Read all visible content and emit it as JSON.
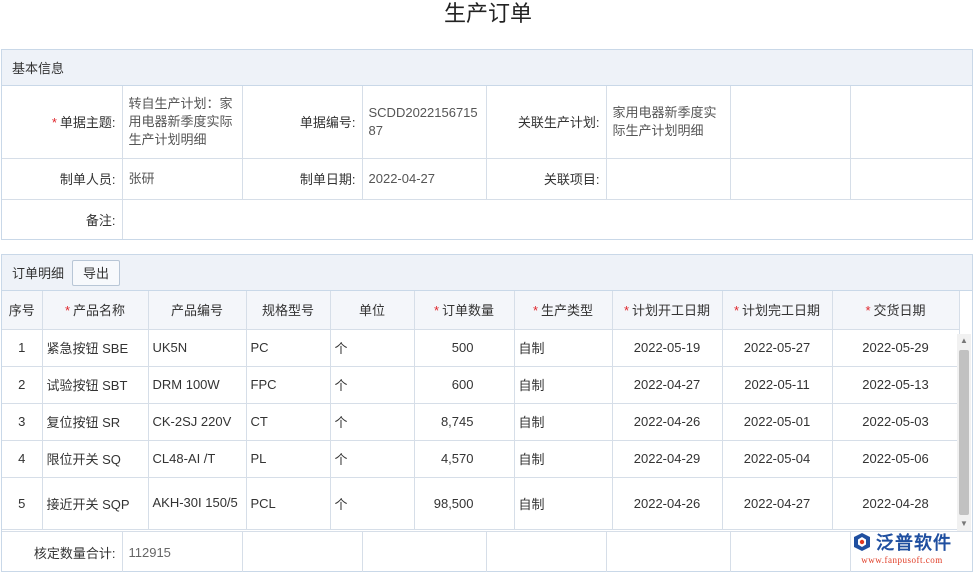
{
  "page": {
    "title": "生产订单"
  },
  "basic_info": {
    "header": "基本信息",
    "subject_label": "单据主题:",
    "subject_value": "转自生产计划：家用电器新季度实际生产计划明细",
    "doc_no_label": "单据编号:",
    "doc_no_value": "SCDD202215671587",
    "plan_label": "关联生产计划:",
    "plan_value": "家用电器新季度实际生产计划明细",
    "maker_label": "制单人员:",
    "maker_value": "张研",
    "date_label": "制单日期:",
    "date_value": "2022-04-27",
    "project_label": "关联项目:",
    "project_value": "",
    "remark_label": "备注:",
    "remark_value": ""
  },
  "order_detail": {
    "header": "订单明细",
    "export_label": "导出",
    "columns": [
      "序号",
      "产品名称",
      "产品编号",
      "规格型号",
      "单位",
      "订单数量",
      "生产类型",
      "计划开工日期",
      "计划完工日期",
      "交货日期"
    ],
    "rows": [
      {
        "no": "1",
        "name": "紧急按钮 SBE",
        "code": "UK5N",
        "spec": "PC",
        "unit": "个",
        "qty": "500",
        "type": "自制",
        "start": "2022-05-19",
        "finish": "2022-05-27",
        "delivery": "2022-05-29"
      },
      {
        "no": "2",
        "name": "试验按钮 SBT",
        "code": "DRM 100W",
        "spec": "FPC",
        "unit": "个",
        "qty": "600",
        "type": "自制",
        "start": "2022-04-27",
        "finish": "2022-05-11",
        "delivery": "2022-05-13"
      },
      {
        "no": "3",
        "name": "复位按钮 SR",
        "code": "CK-2SJ 220V",
        "spec": "CT",
        "unit": "个",
        "qty": "8,745",
        "type": "自制",
        "start": "2022-04-26",
        "finish": "2022-05-01",
        "delivery": "2022-05-03"
      },
      {
        "no": "4",
        "name": "限位开关 SQ",
        "code": "CL48-AI /T",
        "spec": "PL",
        "unit": "个",
        "qty": "4,570",
        "type": "自制",
        "start": "2022-04-29",
        "finish": "2022-05-04",
        "delivery": "2022-05-06"
      },
      {
        "no": "5",
        "name": "接近开关 SQP",
        "code": "AKH-30I 150/5",
        "spec": "PCL",
        "unit": "个",
        "qty": "98,500",
        "type": "自制",
        "start": "2022-04-26",
        "finish": "2022-04-27",
        "delivery": "2022-04-28"
      }
    ],
    "total_label": "核定数量合计:",
    "total_value": "112915"
  },
  "logo": {
    "name": "泛普软件",
    "url": "www.fanpusoft.com"
  },
  "colors": {
    "required": "#e0262c",
    "header_bg": "#eef2f8",
    "border": "#d6dee8",
    "brand": "#1f4fa0"
  }
}
